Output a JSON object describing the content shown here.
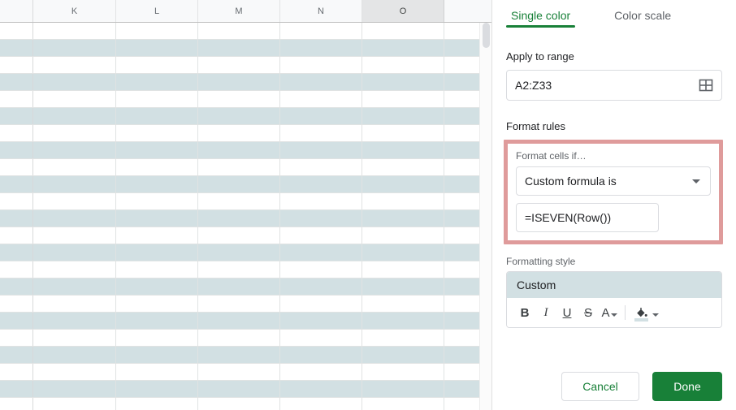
{
  "spreadsheet": {
    "column_headers": [
      "K",
      "L",
      "M",
      "N",
      "O"
    ],
    "selected_column": "O",
    "banding_color": "#d2e0e3",
    "row_count_visible": 23,
    "corner_label": ""
  },
  "panel": {
    "tabs": [
      {
        "label": "Single color",
        "active": true
      },
      {
        "label": "Color scale",
        "active": false
      }
    ],
    "apply_to_range": {
      "label": "Apply to range",
      "value": "A2:Z33",
      "picker_icon": "grid-select-icon"
    },
    "format_rules": {
      "label": "Format rules",
      "highlight_color": "#df9b9b",
      "condition_label": "Format cells if…",
      "condition_value": "Custom formula is",
      "formula_value": "=ISEVEN(Row())"
    },
    "formatting_style": {
      "label": "Formatting style",
      "preview_text": "Custom",
      "preview_bg": "#d2e0e3",
      "toolbar": [
        {
          "name": "bold",
          "glyph": "B"
        },
        {
          "name": "italic",
          "glyph": "I"
        },
        {
          "name": "underline",
          "glyph": "U"
        },
        {
          "name": "strikethrough",
          "glyph": "S"
        },
        {
          "name": "text-color",
          "glyph": "A"
        },
        {
          "name": "fill-color",
          "glyph": ""
        }
      ]
    },
    "actions": {
      "cancel_label": "Cancel",
      "done_label": "Done",
      "accent_color": "#188038"
    }
  }
}
